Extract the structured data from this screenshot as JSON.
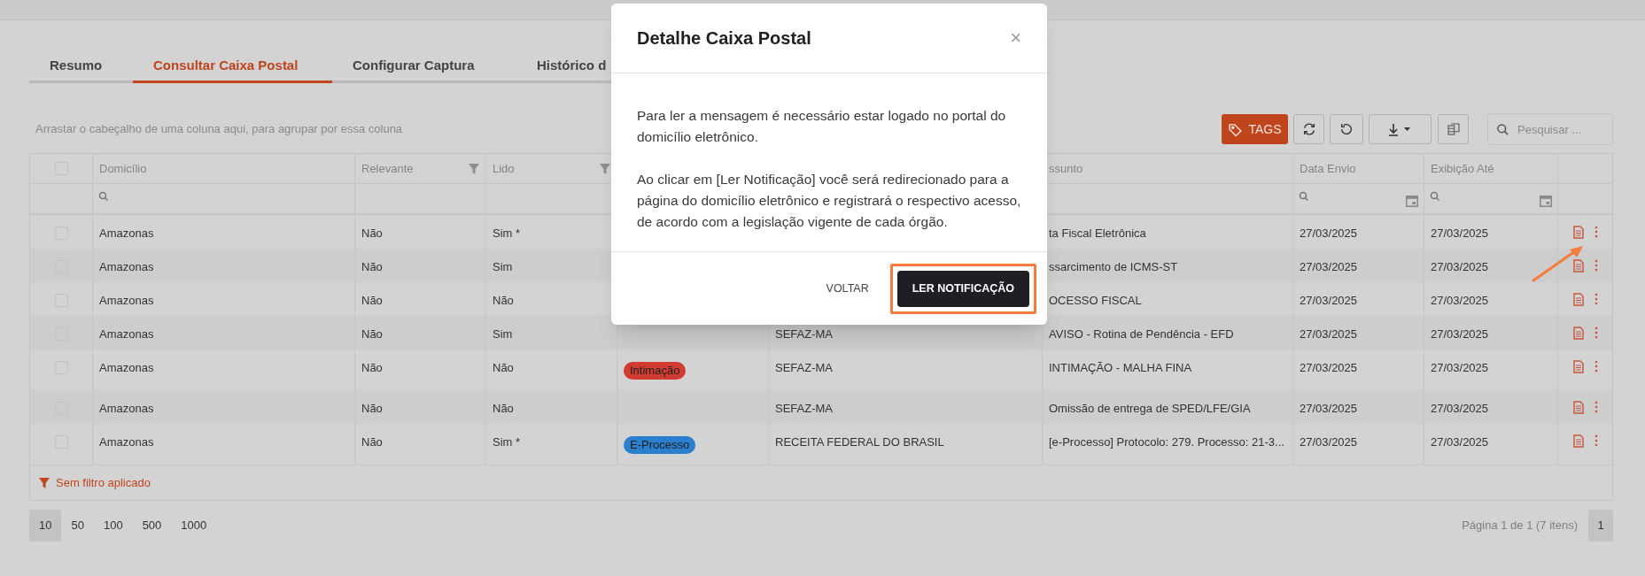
{
  "tabs": [
    {
      "label": "Resumo",
      "selected": false
    },
    {
      "label": "Consultar Caixa Postal",
      "selected": true
    },
    {
      "label": "Configurar Captura",
      "selected": false
    },
    {
      "label": "Histórico d",
      "selected": false
    }
  ],
  "group_hint": "Arrastar o cabeçalho de uma coluna aqui, para agrupar por essa coluna",
  "toolbar": {
    "tags_button": "TAGS",
    "search_placeholder": "Pesquisar ..."
  },
  "table": {
    "select_all_checked": false,
    "columns": [
      {
        "kind": "text",
        "label": "Domicílio",
        "search_filter": true
      },
      {
        "kind": "text",
        "label": "Relevante",
        "header_filter": true
      },
      {
        "kind": "text",
        "label": "Lido",
        "header_filter": true
      },
      {
        "kind": "tag"
      },
      {
        "kind": "text"
      },
      {
        "kind": "text",
        "label": "ssunto"
      },
      {
        "kind": "date",
        "label": "Data Envio",
        "search_filter": true
      },
      {
        "kind": "date",
        "label": "Exibição Até",
        "search_filter": true
      }
    ],
    "rows": [
      {
        "checked": false,
        "cells": [
          "Amazonas",
          "Não",
          "Sim *",
          null,
          null,
          "ta Fiscal Eletrônica",
          "27/03/2025",
          "27/03/2025"
        ]
      },
      {
        "checked": false,
        "cells": [
          "Amazonas",
          "Não",
          "Sim",
          null,
          null,
          "ssarcimento de ICMS-ST",
          "27/03/2025",
          "27/03/2025"
        ]
      },
      {
        "checked": false,
        "cells": [
          "Amazonas",
          "Não",
          "Não",
          null,
          null,
          "OCESSO FISCAL",
          "27/03/2025",
          "27/03/2025"
        ]
      },
      {
        "checked": false,
        "cells": [
          "Amazonas",
          "Não",
          "Sim",
          null,
          "SEFAZ-MA",
          "AVISO - Rotina de Pendência - EFD",
          "27/03/2025",
          "27/03/2025"
        ]
      },
      {
        "checked": false,
        "cells": [
          "Amazonas",
          "Não",
          "Não",
          {
            "label": "Intimação",
            "color": "#d13b30"
          },
          "SEFAZ-MA",
          "INTIMAÇÃO - MALHA FINA",
          "27/03/2025",
          "27/03/2025"
        ]
      },
      {
        "checked": false,
        "cells": [
          "Amazonas",
          "Não",
          "Não",
          null,
          "SEFAZ-MA",
          "Omissão de entrega de SPED/LFE/GIA",
          "27/03/2025",
          "27/03/2025"
        ]
      },
      {
        "checked": false,
        "cells": [
          "Amazonas",
          "Não",
          "Sim *",
          {
            "label": "E-Processo",
            "color": "#2a7fcf"
          },
          "RECEITA FEDERAL DO BRASIL",
          "[e-Processo] Protocolo: 279. Processo: 21-3...",
          "27/03/2025",
          "27/03/2025"
        ]
      }
    ],
    "filter_status": "Sem filtro aplicado"
  },
  "pagination": {
    "page_sizes": [
      {
        "label": "10",
        "selected": true
      },
      {
        "label": "50",
        "selected": false
      },
      {
        "label": "100",
        "selected": false
      },
      {
        "label": "500",
        "selected": false
      },
      {
        "label": "1000",
        "selected": false
      }
    ],
    "page_info": "Página 1 de 1 (7 itens)",
    "pages": [
      {
        "label": "1",
        "selected": true
      }
    ]
  },
  "dialog": {
    "title": "Detalhe Caixa Postal",
    "close": "×",
    "paragraphs": [
      "Para ler a mensagem é necessário estar logado no portal do domicílio eletrônico.",
      "Ao clicar em [Ler Notificação] você será redirecionado para a página do domicílio eletrônico e registrará o respectivo acesso, de acordo com a legislação vigente de cada órgão."
    ],
    "buttons": [
      {
        "label": "VOLTAR",
        "kind": "flat",
        "highlighted": false
      },
      {
        "label": "LER NOTIFICAÇÃO",
        "kind": "primary",
        "highlighted": true
      }
    ]
  }
}
